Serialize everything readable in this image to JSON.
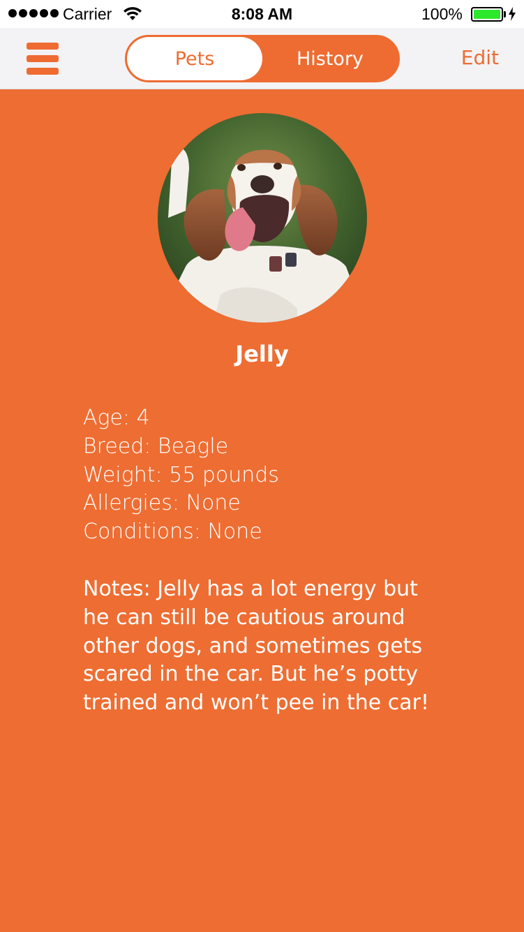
{
  "status_bar": {
    "carrier": "Carrier",
    "time": "8:08 AM",
    "battery_percent": "100%",
    "battery_level": 1.0,
    "signal_bars": 5
  },
  "nav": {
    "menu_icon": "hamburger-menu-icon",
    "tabs": [
      {
        "label": "Pets",
        "selected": true
      },
      {
        "label": "History",
        "selected": false
      }
    ],
    "edit_label": "Edit"
  },
  "colors": {
    "accent": "#ee6c31",
    "background": "#ee6d32",
    "nav_background": "#f3f3f5",
    "text_on_accent": "#ffffff",
    "battery_fill": "#2ee82e"
  },
  "pet": {
    "name": "Jelly",
    "photo_icon": "dog-photo-icon",
    "details": [
      "Age: 4",
      "Breed: Beagle",
      "Weight: 55 pounds",
      "Allergies: None",
      "Conditions: None"
    ],
    "notes_lines": [
      "Notes: Jelly has a lot energy but",
      "he can still be cautious around",
      "other dogs, and sometimes gets",
      "scared in the car. But he’s potty",
      "trained and won’t pee in the car!"
    ]
  }
}
